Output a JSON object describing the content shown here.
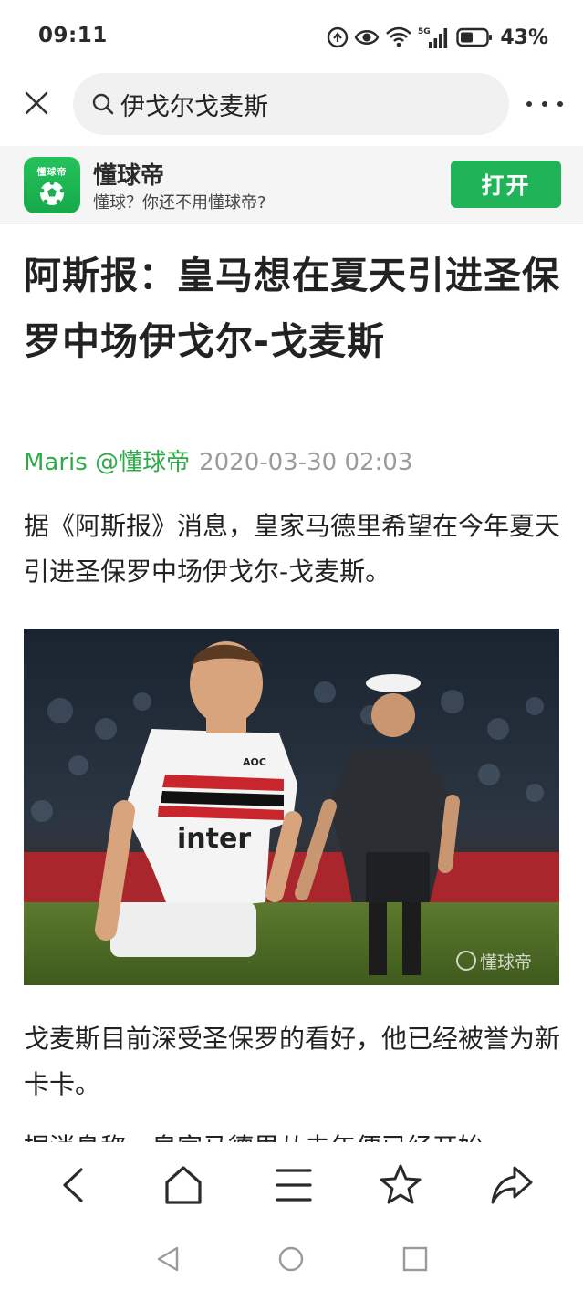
{
  "status_bar": {
    "time": "09:11",
    "signal_label": "5G",
    "battery": "43%"
  },
  "search": {
    "query": "伊戈尔戈麦斯"
  },
  "app_banner": {
    "logo_text": "懂球帝",
    "name": "懂球帝",
    "tagline": "懂球？你还不用懂球帝?",
    "open_label": "打开",
    "accent": "#20b357"
  },
  "article": {
    "headline": "阿斯报：皇马想在夏天引进圣保罗中场伊戈尔-戈麦斯",
    "author": "Maris @懂球帝",
    "date": "2020-03-30 02:03",
    "paragraph1": "据《阿斯报》消息，皇家马德里希望在今年夏天引进圣保罗中场伊戈尔-戈麦斯。",
    "photo_text": {
      "jersey_sponsor": "inter",
      "jersey_small": "AOC",
      "watermark": "懂球帝"
    },
    "paragraph2": "戈麦斯目前深受圣保罗的看好，他已经被誉为新卡卡。",
    "paragraph3": "据消息称，皇家马德里从去年便已经开始"
  },
  "toolbar": {
    "icons": [
      "back-icon",
      "home-icon",
      "menu-icon",
      "star-icon",
      "share-icon"
    ]
  },
  "system_nav": {
    "icons": [
      "nav-back-icon",
      "nav-home-icon",
      "nav-recents-icon"
    ]
  }
}
